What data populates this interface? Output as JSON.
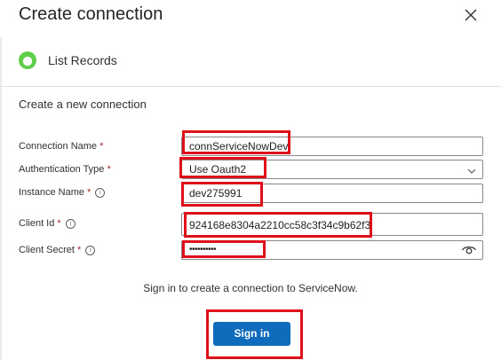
{
  "dialog": {
    "title": "Create connection",
    "close_icon": "close-icon"
  },
  "action": {
    "icon": "servicenow-icon",
    "name": "List Records"
  },
  "section_title": "Create a new connection",
  "fields": {
    "connection_name": {
      "label": "Connection Name",
      "required": "*",
      "value": "connServiceNowDev"
    },
    "auth_type": {
      "label": "Authentication Type",
      "required": "*",
      "value": "Use Oauth2",
      "icon": "chevron-down-icon"
    },
    "instance_name": {
      "label": "Instance Name",
      "required": "*",
      "value": "dev275991",
      "info_icon": "info-icon"
    },
    "client_id": {
      "label": "Client Id",
      "required": "*",
      "value": "924168e8304a2210cc58c3f34c9b62f3",
      "info_icon": "info-icon"
    },
    "client_secret": {
      "label": "Client Secret",
      "required": "*",
      "value": "••••••••••",
      "info_icon": "info-icon",
      "icon": "eye-icon"
    }
  },
  "hint": "Sign in to create a connection to ServiceNow.",
  "sign_in_label": "Sign in",
  "colors": {
    "primary": "#0f6cbd",
    "highlight": "#e0101a",
    "required": "#a4262c",
    "app_icon": "#62d84e"
  }
}
